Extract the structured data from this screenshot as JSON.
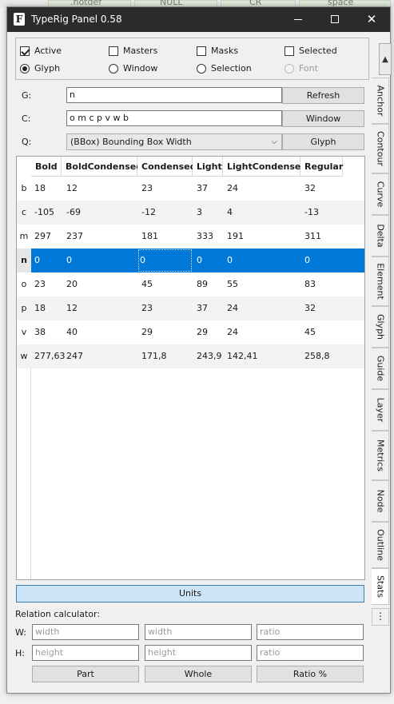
{
  "background": {
    "labels": [
      ".notdef",
      "NULL",
      "CR",
      "space"
    ]
  },
  "window": {
    "title": "TypeRig Panel 0.58",
    "icon_letter": "F"
  },
  "options": {
    "active": {
      "label": "Active",
      "checked": true
    },
    "masters": {
      "label": "Masters",
      "checked": false
    },
    "masks": {
      "label": "Masks",
      "checked": false
    },
    "selected": {
      "label": "Selected",
      "checked": false
    },
    "glyph": {
      "label": "Glyph",
      "selected": true
    },
    "window": {
      "label": "Window",
      "selected": false
    },
    "selection": {
      "label": "Selection",
      "selected": false
    },
    "font": {
      "label": "Font",
      "selected": false
    }
  },
  "fields": {
    "g": {
      "label": "G:",
      "value": "n"
    },
    "c": {
      "label": "C:",
      "value": "o m c p v w b"
    },
    "q": {
      "label": "Q:",
      "value": "(BBox) Bounding Box Width"
    }
  },
  "buttons": {
    "refresh": "Refresh",
    "window": "Window",
    "glyph": "Glyph",
    "units": "Units",
    "part": "Part",
    "whole": "Whole",
    "ratio": "Ratio %"
  },
  "table": {
    "headers": [
      "Bold",
      "BoldCondensed",
      "Condensed",
      "Light",
      "LightCondensed",
      "Regular"
    ],
    "rows": [
      {
        "glyph": "b",
        "values": [
          "18",
          "12",
          "23",
          "37",
          "24",
          "32"
        ]
      },
      {
        "glyph": "c",
        "values": [
          "-105",
          "-69",
          "-12",
          "3",
          "4",
          "-13"
        ]
      },
      {
        "glyph": "m",
        "values": [
          "297",
          "237",
          "181",
          "333",
          "191",
          "311"
        ]
      },
      {
        "glyph": "n",
        "values": [
          "0",
          "0",
          "0",
          "0",
          "0",
          "0"
        ]
      },
      {
        "glyph": "o",
        "values": [
          "23",
          "20",
          "45",
          "89",
          "55",
          "83"
        ]
      },
      {
        "glyph": "p",
        "values": [
          "18",
          "12",
          "23",
          "37",
          "24",
          "32"
        ]
      },
      {
        "glyph": "v",
        "values": [
          "38",
          "40",
          "29",
          "29",
          "24",
          "45"
        ]
      },
      {
        "glyph": "w",
        "values": [
          "277,63",
          "247",
          "171,8",
          "243,9",
          "142,41",
          "258,8"
        ]
      }
    ],
    "selected_row": "n"
  },
  "relation": {
    "title": "Relation calculator:",
    "w_label": "W:",
    "h_label": "H:",
    "placeholders": {
      "width": "width",
      "height": "height",
      "ratio": "ratio"
    }
  },
  "side_tabs": [
    "Anchor",
    "Contour",
    "Curve",
    "Delta",
    "Element",
    "Glyph",
    "Guide",
    "Layer",
    "Metrics",
    "Node",
    "Outline",
    "Stats"
  ],
  "active_side_tab": "Stats",
  "side_more": "⋮",
  "colors": {
    "selection": "#0078d7",
    "titlebar": "#2b2b2b",
    "units_button": "#cce4f7"
  }
}
